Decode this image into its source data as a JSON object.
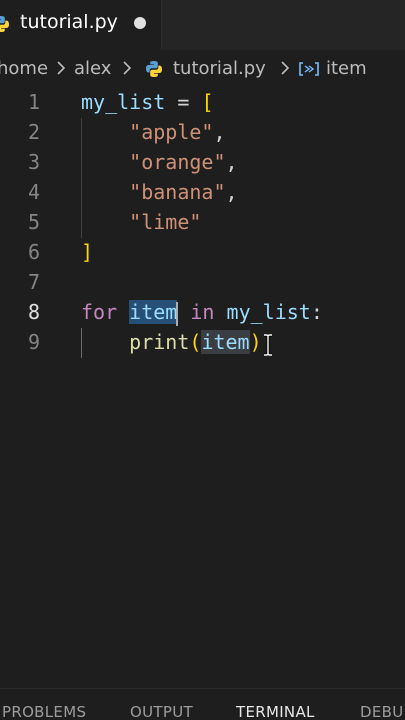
{
  "tab": {
    "label": "tutorial.py",
    "icon": "python-icon",
    "unsaved": true
  },
  "breadcrumb": {
    "items": [
      "home",
      "alex",
      "tutorial.py",
      "item"
    ],
    "separator": ">"
  },
  "editor": {
    "lines": [
      {
        "num": "1",
        "text": "my_list = ["
      },
      {
        "num": "2",
        "text": "\"apple\","
      },
      {
        "num": "3",
        "text": "\"orange\","
      },
      {
        "num": "4",
        "text": "\"banana\","
      },
      {
        "num": "5",
        "text": "\"lime\""
      },
      {
        "num": "6",
        "text": "]"
      },
      {
        "num": "7",
        "text": ""
      },
      {
        "num": "8",
        "text": "for item in my_list:"
      },
      {
        "num": "9",
        "text": "print(item)"
      }
    ],
    "tokens": {
      "my_list": "my_list",
      "equals": "=",
      "open_bracket": "[",
      "close_bracket": "]",
      "s_apple": "\"apple\"",
      "s_orange": "\"orange\"",
      "s_banana": "\"banana\"",
      "s_lime": "\"lime\"",
      "comma": ",",
      "kw_for": "for",
      "item": "item",
      "kw_in": "in",
      "colon": ":",
      "fn_print": "print",
      "open_paren": "(",
      "close_paren": ")"
    },
    "active_line": "8"
  },
  "panel": {
    "tabs": [
      "PROBLEMS",
      "OUTPUT",
      "TERMINAL",
      "DEBU"
    ],
    "active": "TERMINAL"
  },
  "colors": {
    "background": "#1e1e1e",
    "variable": "#9cdcfe",
    "string": "#ce9178",
    "keyword": "#c586c0",
    "function": "#dcdcaa",
    "bracket": "#ffd700",
    "selection": "#264f78"
  }
}
